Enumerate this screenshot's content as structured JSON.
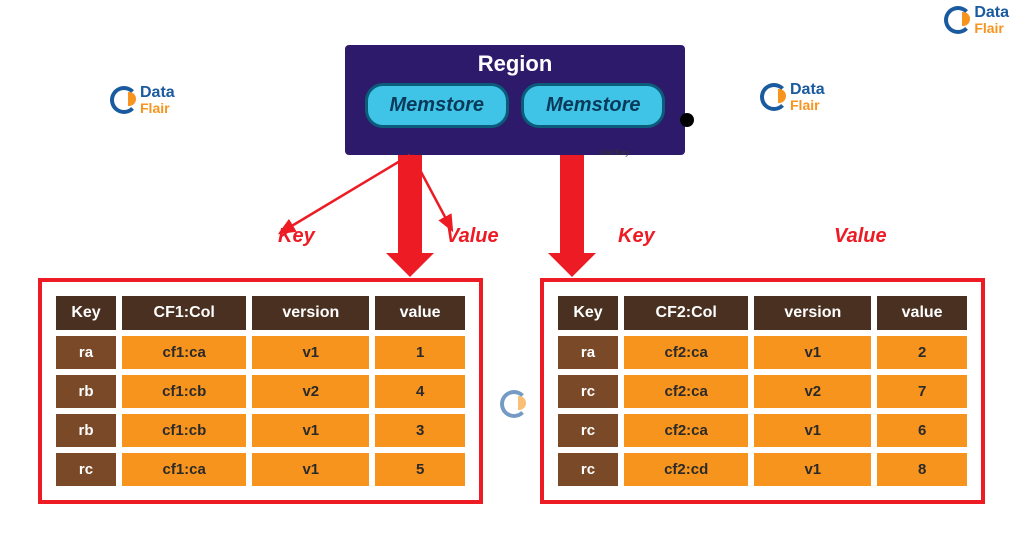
{
  "logo": {
    "top": "Data",
    "bottom": "Flair"
  },
  "region": {
    "title": "Region",
    "memstore_left": "Memstore",
    "memstore_right": "Memstore",
    "startKeyLabel": "startKey"
  },
  "labels": {
    "key_left": "Key",
    "value_left": "Value",
    "key_right": "Key",
    "value_right": "Value"
  },
  "table_left": {
    "headers": [
      "Key",
      "CF1:Col",
      "version",
      "value"
    ],
    "rows": [
      [
        "ra",
        "cf1:ca",
        "v1",
        "1"
      ],
      [
        "rb",
        "cf1:cb",
        "v2",
        "4"
      ],
      [
        "rb",
        "cf1:cb",
        "v1",
        "3"
      ],
      [
        "rc",
        "cf1:ca",
        "v1",
        "5"
      ]
    ]
  },
  "table_right": {
    "headers": [
      "Key",
      "CF2:Col",
      "version",
      "value"
    ],
    "rows": [
      [
        "ra",
        "cf2:ca",
        "v1",
        "2"
      ],
      [
        "rc",
        "cf2:ca",
        "v2",
        "7"
      ],
      [
        "rc",
        "cf2:ca",
        "v1",
        "6"
      ],
      [
        "rc",
        "cf2:cd",
        "v1",
        "8"
      ]
    ]
  }
}
